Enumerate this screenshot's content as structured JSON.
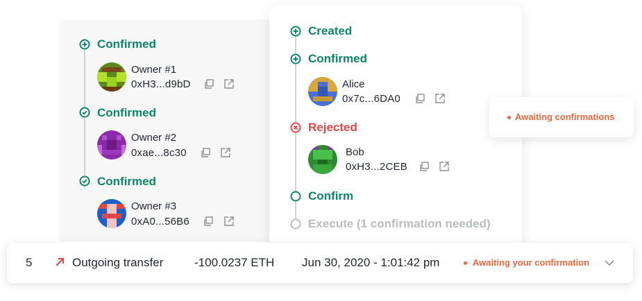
{
  "left_timeline": {
    "steps": [
      {
        "label": "Confirmed",
        "icon": "plus-circle-icon",
        "owner": {
          "name": "Owner #1",
          "address": "0xH3...d9bD"
        }
      },
      {
        "label": "Confirmed",
        "icon": "check-circle-icon",
        "owner": {
          "name": "Owner #2",
          "address": "0xae...8c30"
        }
      },
      {
        "label": "Confirmed",
        "icon": "check-circle-icon",
        "owner": {
          "name": "Owner #3",
          "address": "0xA0...56B6"
        }
      }
    ]
  },
  "center_timeline": {
    "created_label": "Created",
    "confirmed_label": "Confirmed",
    "confirmed_owner": {
      "name": "Alice",
      "address": "0x7c...6DA0"
    },
    "rejected_label": "Rejected",
    "rejected_owner": {
      "name": "Bob",
      "address": "0xH3...2CEB"
    },
    "confirm_label": "Confirm",
    "execute_label": "Execute (1 confirmation needed)"
  },
  "badge_card": {
    "status": "Awaiting confirmations"
  },
  "transaction": {
    "nonce": "5",
    "type_label": "Outgoing transfer",
    "amount": "-100.0237 ETH",
    "date": "Jun 30, 2020 - 1:01:42 pm",
    "status": "Awaiting your confirmation"
  },
  "colors": {
    "green": "#0b8567",
    "red": "#e04848",
    "orange": "#e8663d",
    "grey": "#b8bcbf"
  }
}
